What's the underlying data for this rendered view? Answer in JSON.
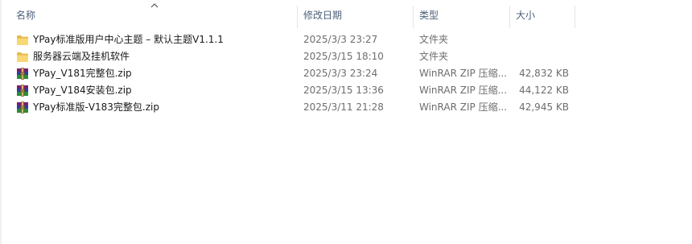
{
  "header": {
    "name": "名称",
    "date_modified": "修改日期",
    "type": "类型",
    "size": "大小",
    "sort_indicator_icon": "sort-ascending-chevron"
  },
  "files": [
    {
      "name": "YPay标准版用户中心主题 – 默认主题V1.1.1",
      "date": "2025/3/3 23:27",
      "type": "文件夹",
      "size": "",
      "icon": "folder-icon"
    },
    {
      "name": "服务器云端及挂机软件",
      "date": "2025/3/15 18:10",
      "type": "文件夹",
      "size": "",
      "icon": "folder-icon"
    },
    {
      "name": "YPay_V181完整包.zip",
      "date": "2025/3/3 23:24",
      "type": "WinRAR ZIP 压缩...",
      "size": "42,832 KB",
      "icon": "winrar-archive-icon"
    },
    {
      "name": "YPay_V184安装包.zip",
      "date": "2025/3/15 13:36",
      "type": "WinRAR ZIP 压缩...",
      "size": "44,122 KB",
      "icon": "winrar-archive-icon"
    },
    {
      "name": "YPay标准版-V183完整包.zip",
      "date": "2025/3/11 21:28",
      "type": "WinRAR ZIP 压缩...",
      "size": "42,945 KB",
      "icon": "winrar-archive-icon"
    }
  ],
  "colors": {
    "header_text": "#4c607a",
    "folder_yellow": "#f8d775",
    "row_text": "#1a1a1a",
    "meta_text": "#6d6d6d"
  }
}
